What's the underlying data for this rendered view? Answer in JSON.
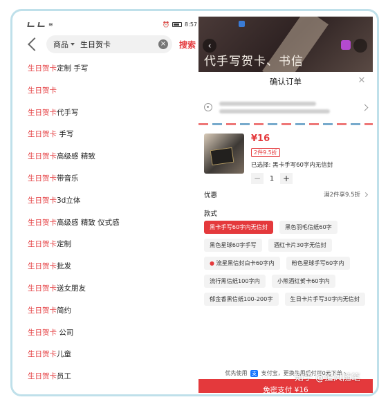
{
  "left": {
    "status": {
      "time": "8:57"
    },
    "search": {
      "scope": "商品",
      "query": "生日贺卡",
      "button": "搜索"
    },
    "keyword": "生日贺卡",
    "suggestions": [
      {
        "kw": "生日贺卡",
        "rest": "定制 手写"
      },
      {
        "kw": "生日贺卡",
        "rest": ""
      },
      {
        "kw": "生日贺卡",
        "rest": "代手写"
      },
      {
        "kw": "生日贺卡",
        "rest": " 手写"
      },
      {
        "kw": "生日贺卡",
        "rest": "高级感 精致"
      },
      {
        "kw": "生日贺卡",
        "rest": "带音乐"
      },
      {
        "kw": "生日贺卡",
        "rest": "3d立体"
      },
      {
        "kw": "生日贺卡",
        "rest": "高级感 精致 仪式感"
      },
      {
        "kw": "生日贺卡",
        "rest": "定制"
      },
      {
        "kw": "生日贺卡",
        "rest": "批发"
      },
      {
        "kw": "生日贺卡",
        "rest": "送女朋友"
      },
      {
        "kw": "生日贺卡",
        "rest": "简约"
      },
      {
        "kw": "生日贺卡",
        "rest": " 公司"
      },
      {
        "kw": "生日贺卡",
        "rest": "儿童"
      },
      {
        "kw": "生日贺卡",
        "rest": "员工"
      }
    ]
  },
  "right": {
    "banner": {
      "title": "代手写贺卡、书信"
    },
    "sheet": {
      "title": "确认订单",
      "price": "¥16",
      "discount_tag": "2件9.5折",
      "selected": "已选择:   黑卡手写60字内无信封",
      "quantity": "1",
      "promo_label": "优惠",
      "promo_value": "满2件享9.5折",
      "style_label": "款式",
      "options": [
        {
          "label": "黑卡手写60字内无信封",
          "selected": true,
          "flame": false
        },
        {
          "label": "黑色羽毛信纸60字",
          "selected": false,
          "flame": false
        },
        {
          "label": "黑色星球60字手写",
          "selected": false,
          "flame": false
        },
        {
          "label": "酒红卡片30字无信封",
          "selected": false,
          "flame": false
        },
        {
          "label": "流星黑信封白卡60字内",
          "selected": false,
          "flame": true
        },
        {
          "label": "粉色星球手写60字内",
          "selected": false,
          "flame": false
        },
        {
          "label": "流行黑信纸100字内",
          "selected": false,
          "flame": false
        },
        {
          "label": "小熊酒红贺卡60字内",
          "selected": false,
          "flame": false
        },
        {
          "label": "郁金香黑信纸100-200字",
          "selected": false,
          "flame": false
        },
        {
          "label": "生日卡片手写30字内无信封",
          "selected": false,
          "flame": false
        }
      ],
      "pay_note_pre": "优先使用",
      "alipay_badge": "支",
      "pay_note_post": "支付宝，更换先用后付可0元下单",
      "pay_button": "免密支付 ¥16"
    }
  },
  "watermark": "知乎 @追风随笔",
  "colors": {
    "accent": "#e4393c",
    "frame": "#bfe0ea"
  }
}
